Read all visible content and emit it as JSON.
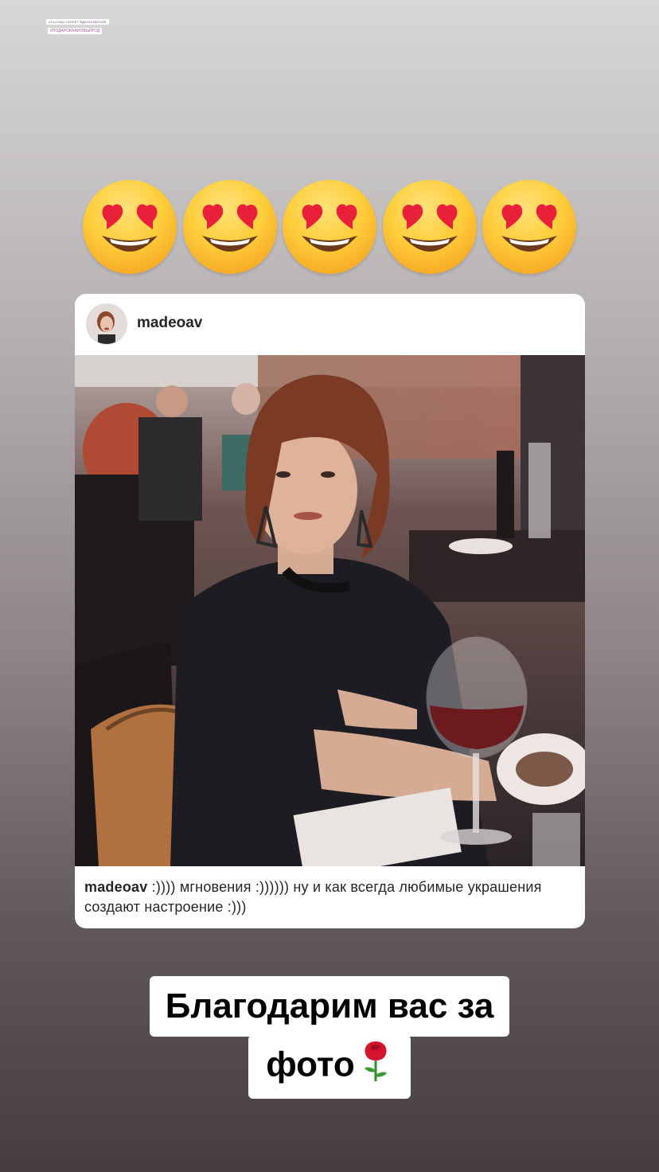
{
  "story": {
    "mention_tag": "#ТЫ НАШ СЕКРЕТ ВДОХНОВЕНИЯ",
    "hashtag": "#ПОДАРОКНАНОВЫЙГОД",
    "emoji_reaction": "heart-eyes-emoji",
    "emoji_count": 5
  },
  "post": {
    "username": "madeoav",
    "caption_user": "madeoav",
    "caption_text": " :)))) мгновения :)))))) ну и как всегда любимые украшения создают настроение :)))"
  },
  "banner": {
    "line1": "Благодарим вас за",
    "line2": "фото",
    "emoji": "rose-emoji"
  },
  "colors": {
    "background_top": "#d8d6d6",
    "background_bottom": "#453d40",
    "card_bg": "#ffffff",
    "text": "#262626",
    "heart": "#e8203a"
  }
}
